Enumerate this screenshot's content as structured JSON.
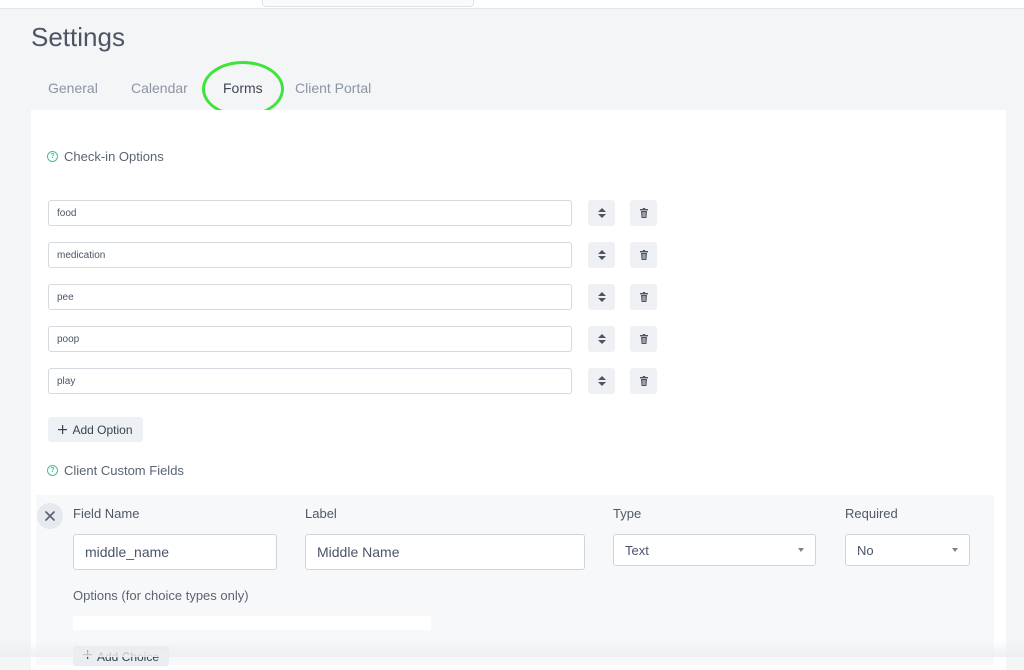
{
  "page": {
    "title": "Settings"
  },
  "tabs": [
    {
      "label": "General"
    },
    {
      "label": "Calendar"
    },
    {
      "label": "Forms",
      "active": true
    },
    {
      "label": "Client Portal"
    }
  ],
  "checkin": {
    "title": "Check-in Options",
    "options": [
      {
        "value": "food"
      },
      {
        "value": "medication"
      },
      {
        "value": "pee"
      },
      {
        "value": "poop"
      },
      {
        "value": "play"
      }
    ],
    "add_label": "Add Option"
  },
  "custom_fields": {
    "title": "Client Custom Fields",
    "columns": {
      "field_name": "Field Name",
      "label": "Label",
      "type": "Type",
      "required": "Required"
    },
    "field": {
      "name": "middle_name",
      "label": "Middle Name",
      "type": "Text",
      "required": "No"
    },
    "options_label": "Options (for choice types only)",
    "add_choice_label": "Add Choice"
  },
  "colors": {
    "accent": "#3fbf9f",
    "highlight": "#3ee43c"
  }
}
